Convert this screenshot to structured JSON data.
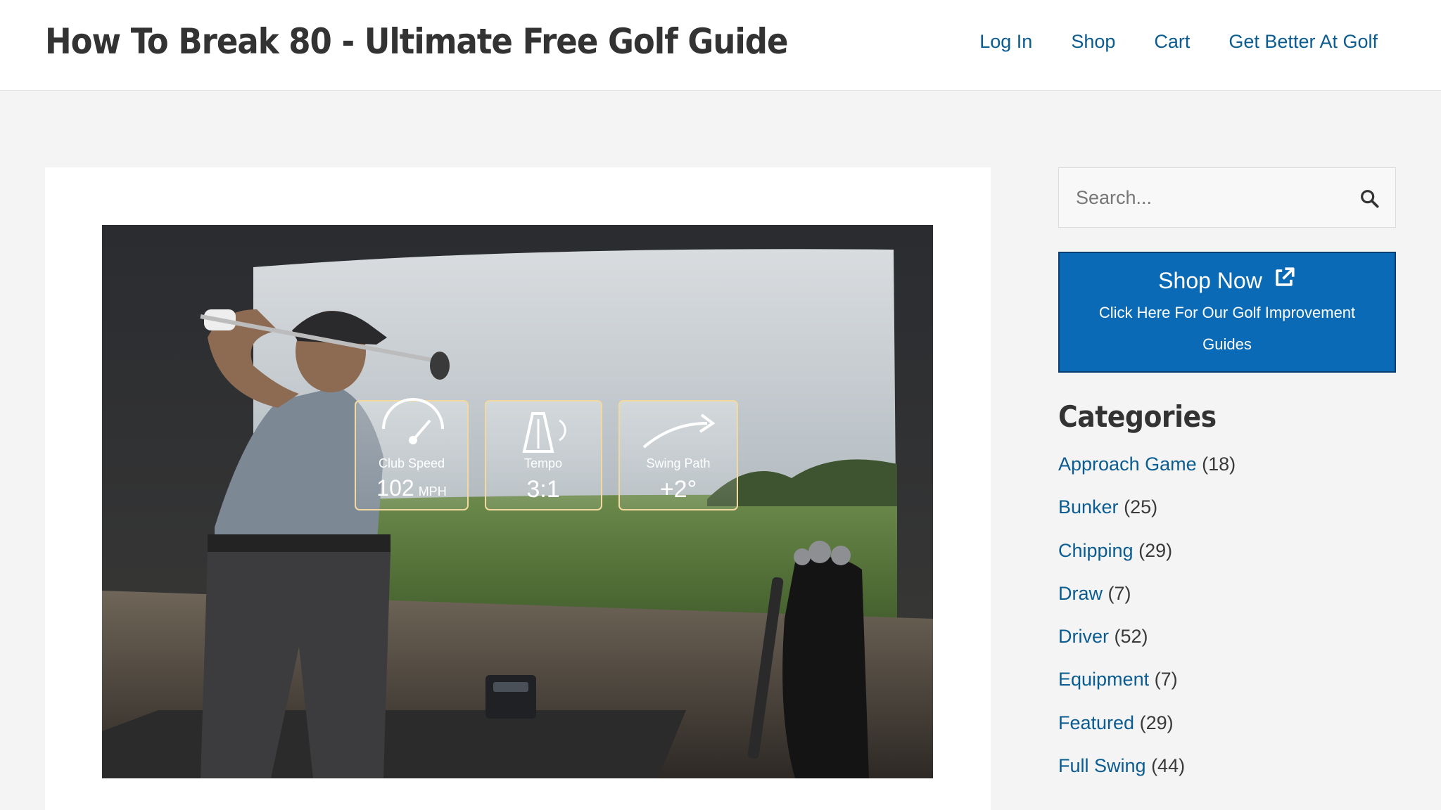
{
  "header": {
    "site_title": "How To Break 80 - Ultimate Free Golf Guide",
    "nav": [
      {
        "label": "Log In"
      },
      {
        "label": "Shop"
      },
      {
        "label": "Cart"
      },
      {
        "label": "Get Better At Golf"
      }
    ]
  },
  "hero": {
    "alt": "Golfer swinging in an indoor golf simulator",
    "metrics": [
      {
        "label": "Club Speed",
        "value": "102",
        "unit": "MPH",
        "icon": "speedometer-icon"
      },
      {
        "label": "Tempo",
        "value": "3:1",
        "unit": "",
        "icon": "metronome-icon"
      },
      {
        "label": "Swing Path",
        "value": "+2°",
        "unit": "",
        "icon": "trend-arrow-icon"
      }
    ]
  },
  "sidebar": {
    "search": {
      "placeholder": "Search...",
      "icon": "search-icon"
    },
    "shop": {
      "title": "Shop Now",
      "icon": "external-link-icon",
      "subtitle": "Click Here For Our Golf Improvement Guides"
    },
    "categories_heading": "Categories",
    "categories": [
      {
        "name": "Approach Game",
        "count": "(18)"
      },
      {
        "name": "Bunker",
        "count": "(25)"
      },
      {
        "name": "Chipping",
        "count": "(29)"
      },
      {
        "name": "Draw",
        "count": "(7)"
      },
      {
        "name": "Driver",
        "count": "(52)"
      },
      {
        "name": "Equipment",
        "count": "(7)"
      },
      {
        "name": "Featured",
        "count": "(29)"
      },
      {
        "name": "Full Swing",
        "count": "(44)"
      }
    ]
  },
  "colors": {
    "link": "#0a5c91",
    "shop_button": "#0a6ab5",
    "page_background": "#f4f4f4",
    "title_text": "#333333"
  }
}
